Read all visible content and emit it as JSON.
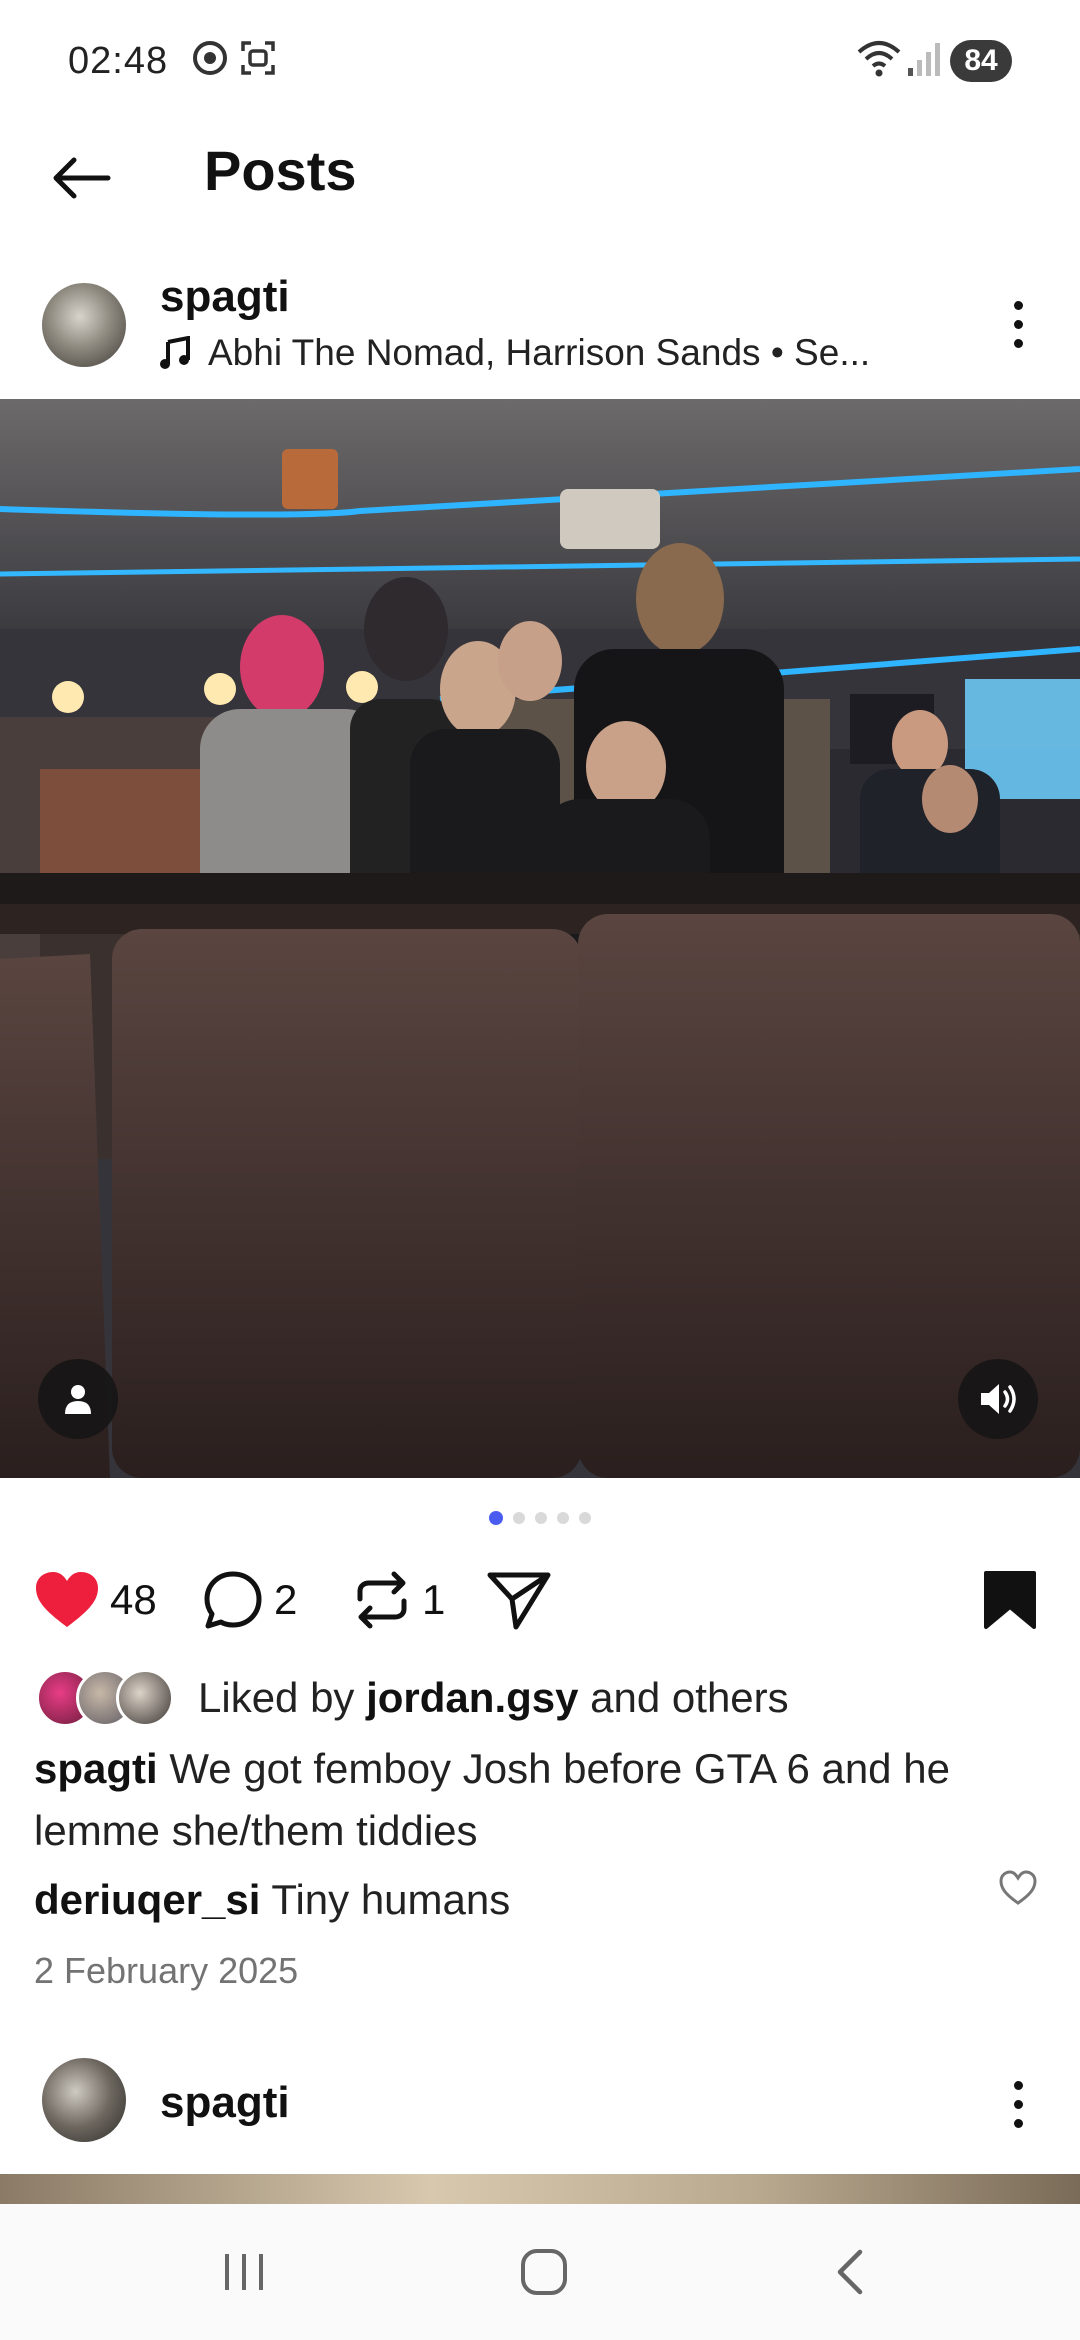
{
  "status_bar": {
    "time": "02:48",
    "icons": [
      "chrome-icon",
      "screenshot-icon",
      "wifi-icon",
      "signal-icon"
    ],
    "battery": "84"
  },
  "header": {
    "title": "Posts",
    "back_icon": "arrow-left-icon"
  },
  "post": {
    "username": "spagti",
    "music": "Abhi The Nomad, Harrison Sands • Se...",
    "music_icon": "music-note-icon",
    "more_icon": "more-vertical-icon",
    "carousel": {
      "total": 5,
      "active": 1
    },
    "actions": {
      "likes": "48",
      "comments": "2",
      "reposts": "1",
      "liked": true,
      "saved": true
    },
    "liked_by": {
      "prefix": "Liked by",
      "user": "jordan.gsy",
      "suffix": "and others"
    },
    "caption": {
      "user": "spagti",
      "text": "We got femboy Josh before GTA 6 and he lemme she/them tiddies"
    },
    "comment": {
      "user": "deriuqer_si",
      "text": "Tiny humans"
    },
    "date": "2 February 2025",
    "accent_color": "#ed1f3c"
  },
  "next_post": {
    "username": "spagti"
  },
  "nav": {
    "icons": [
      "recent-apps-icon",
      "home-icon",
      "back-icon"
    ]
  }
}
